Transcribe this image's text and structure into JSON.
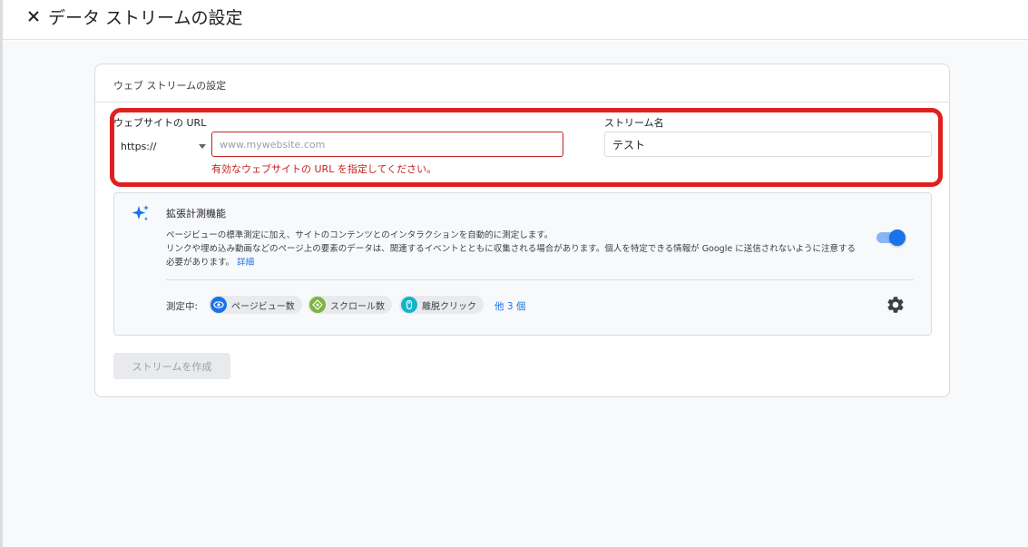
{
  "header": {
    "close_icon": "close-icon",
    "title": "データ ストリームの設定"
  },
  "card": {
    "title": "ウェブ ストリームの設定",
    "url_label": "ウェブサイトの URL",
    "protocol_value": "https://",
    "url_placeholder": "www.mywebsite.com",
    "url_error": "有効なウェブサイトの URL を指定してください。",
    "stream_name_label": "ストリーム名",
    "stream_name_value": "テスト"
  },
  "enhanced": {
    "icon": "sparkle-icon",
    "title": "拡張計測機能",
    "desc_line1": "ページビューの標準測定に加え、サイトのコンテンツとのインタラクションを自動的に測定します。",
    "desc_line2": "リンクや埋め込み動画などのページ上の要素のデータは、関連するイベントとともに収集される場合があります。個人を特定できる情報が Google に送信されないように注意する",
    "desc_line3": "必要があります。",
    "learn_more": "詳細",
    "toggle_on": true,
    "measuring_label": "測定中:",
    "chips": [
      {
        "label": "ページビュー数",
        "icon": "eye-icon",
        "color": "#1a73e8"
      },
      {
        "label": "スクロール数",
        "icon": "compass-icon",
        "color": "#7cb342"
      },
      {
        "label": "離脱クリック",
        "icon": "mouse-icon",
        "color": "#12b5cb"
      }
    ],
    "more": "他 3 個",
    "settings_icon": "gear-icon"
  },
  "actions": {
    "create_label": "ストリームを作成"
  },
  "colors": {
    "error": "#c5221f",
    "accent": "#1a73e8",
    "highlight": "#e02020"
  }
}
